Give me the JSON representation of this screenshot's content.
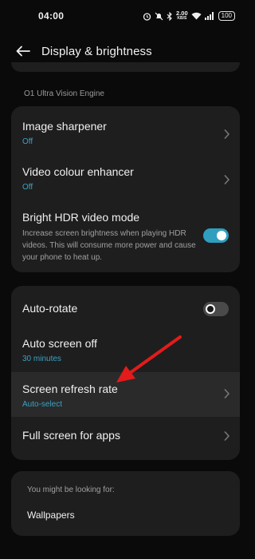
{
  "status_bar": {
    "time": "04:00",
    "net_speed_value": "2.00",
    "net_speed_unit": "KB/S",
    "battery": "100"
  },
  "header": {
    "title": "Display & brightness"
  },
  "section": {
    "label": "O1 Ultra Vision Engine"
  },
  "vision_card": {
    "image_sharpener": {
      "title": "Image sharpener",
      "value": "Off"
    },
    "video_colour_enhancer": {
      "title": "Video colour enhancer",
      "value": "Off"
    },
    "bright_hdr": {
      "title": "Bright HDR video mode",
      "description": "Increase screen brightness when playing HDR videos. This will consume more power and cause your phone to heat up.",
      "enabled": true
    }
  },
  "screen_card": {
    "auto_rotate": {
      "title": "Auto-rotate",
      "enabled": false
    },
    "auto_screen_off": {
      "title": "Auto screen off",
      "value": "30 minutes"
    },
    "refresh_rate": {
      "title": "Screen refresh rate",
      "value": "Auto-select"
    },
    "full_screen": {
      "title": "Full screen for apps"
    }
  },
  "suggestions": {
    "label": "You might be looking for:",
    "item": "Wallpapers"
  },
  "colors": {
    "accent": "#2f9fc0",
    "annotation_arrow": "#e31b1b"
  }
}
